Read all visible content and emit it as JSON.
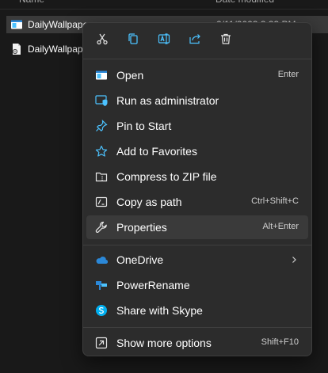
{
  "explorer": {
    "columns": {
      "name": "Name",
      "date_modified": "Date modified"
    },
    "files": [
      {
        "name": "DailyWallpaper",
        "date": "2/11/2023 3:33 PM",
        "icon": "application-window-icon",
        "selected": true
      },
      {
        "name": "DailyWallpaper",
        "date": "",
        "icon": "config-file-icon",
        "selected": false
      }
    ]
  },
  "context_menu": {
    "quick_actions": [
      {
        "name": "cut",
        "icon": "scissors-icon"
      },
      {
        "name": "copy",
        "icon": "copy-icon"
      },
      {
        "name": "rename",
        "icon": "rename-icon"
      },
      {
        "name": "share",
        "icon": "share-icon"
      },
      {
        "name": "delete",
        "icon": "trash-icon"
      }
    ],
    "items": [
      {
        "label": "Open",
        "shortcut": "Enter",
        "icon": "app-window-icon"
      },
      {
        "label": "Run as administrator",
        "shortcut": "",
        "icon": "shield-window-icon"
      },
      {
        "label": "Pin to Start",
        "shortcut": "",
        "icon": "pin-icon"
      },
      {
        "label": "Add to Favorites",
        "shortcut": "",
        "icon": "star-icon"
      },
      {
        "label": "Compress to ZIP file",
        "shortcut": "",
        "icon": "zip-folder-icon"
      },
      {
        "label": "Copy as path",
        "shortcut": "Ctrl+Shift+C",
        "icon": "path-icon"
      },
      {
        "label": "Properties",
        "shortcut": "Alt+Enter",
        "icon": "wrench-icon"
      },
      {
        "label": "OneDrive",
        "shortcut": "",
        "icon": "onedrive-cloud-icon",
        "submenu": true
      },
      {
        "label": "PowerRename",
        "shortcut": "",
        "icon": "powerrename-icon"
      },
      {
        "label": "Share with Skype",
        "shortcut": "",
        "icon": "skype-icon"
      },
      {
        "label": "Show more options",
        "shortcut": "Shift+F10",
        "icon": "more-options-icon"
      }
    ]
  },
  "colors": {
    "accent": "#4cc2ff",
    "menu_bg": "#2c2c2c",
    "hover_bg": "#3a3a3a",
    "onedrive": "#2b88d8",
    "skype": "#00aff0"
  }
}
